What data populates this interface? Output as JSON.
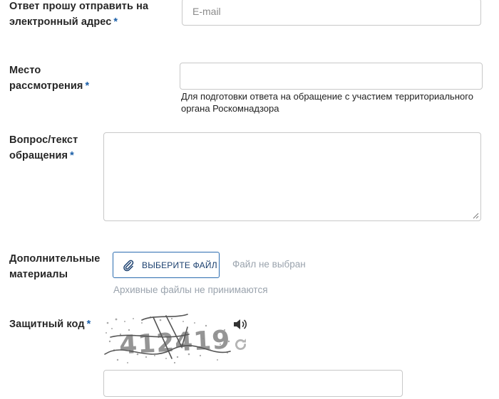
{
  "form": {
    "reply_label": "Ответ прошу отправить на электронный адрес",
    "email_placeholder": "E-mail",
    "place_label": "Место рассмотрения",
    "place_hint": "Для подготовки ответа на обращение с участием территориального органа Роскомнадзора",
    "question_label": "Вопрос/текст обращения",
    "attachments_label": "Дополнительные материалы",
    "choose_file": "ВЫБЕРИТЕ ФАЙЛ",
    "no_file": "Файл не выбран",
    "archive_note": "Архивные файлы не принимаются",
    "captcha_label": "Защитный код",
    "captcha_text": "412419",
    "required_mark": "*"
  },
  "colors": {
    "accent": "#2b6cb0",
    "required": "#1b5fa8",
    "border": "#c8c8c8",
    "muted": "#9aa3ad"
  },
  "icons": [
    "paperclip-icon",
    "speaker-icon",
    "refresh-icon",
    "resize-grip-icon"
  ]
}
